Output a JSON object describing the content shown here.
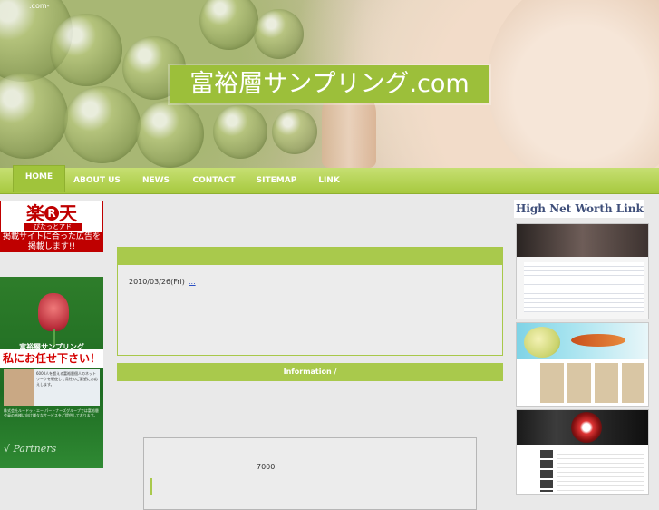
{
  "header": {
    "corner_text": ".com-",
    "title": "富裕層サンプリング.com"
  },
  "nav": {
    "items": [
      {
        "label": "HOME",
        "active": true
      },
      {
        "label": "ABOUT US"
      },
      {
        "label": "NEWS"
      },
      {
        "label": "CONTACT"
      },
      {
        "label": "SITEMAP"
      },
      {
        "label": "LINK"
      }
    ]
  },
  "left": {
    "rakuten": {
      "logo_left": "楽",
      "logo_mid": "R",
      "logo_right": "天",
      "sub": "ぴたっとアド",
      "text": "掲載サイトに合った広告を掲載します!!"
    },
    "partners_banner": {
      "title": "富裕層サンプリング",
      "catch": "私にお任せ下さい！",
      "photo_text": "6000人を超える富裕層個人のネットワークを駆使して貴社のご要望にお応えします。",
      "small_text": "株式会社ルードゥ・エー パートナーズグループでは富裕層会員の皆様に向け様々なサービスをご提供しております。",
      "brand": "√ Partners"
    }
  },
  "center": {
    "date": "2010/03/26(Fri)",
    "link_text": "...",
    "info_label": "Information /",
    "number": "7000"
  },
  "right": {
    "title": "High Net Worth Link"
  },
  "colors": {
    "accent_green": "#a9c94c",
    "nav_green": "#a7c93f",
    "rakuten_red": "#bf0000"
  }
}
